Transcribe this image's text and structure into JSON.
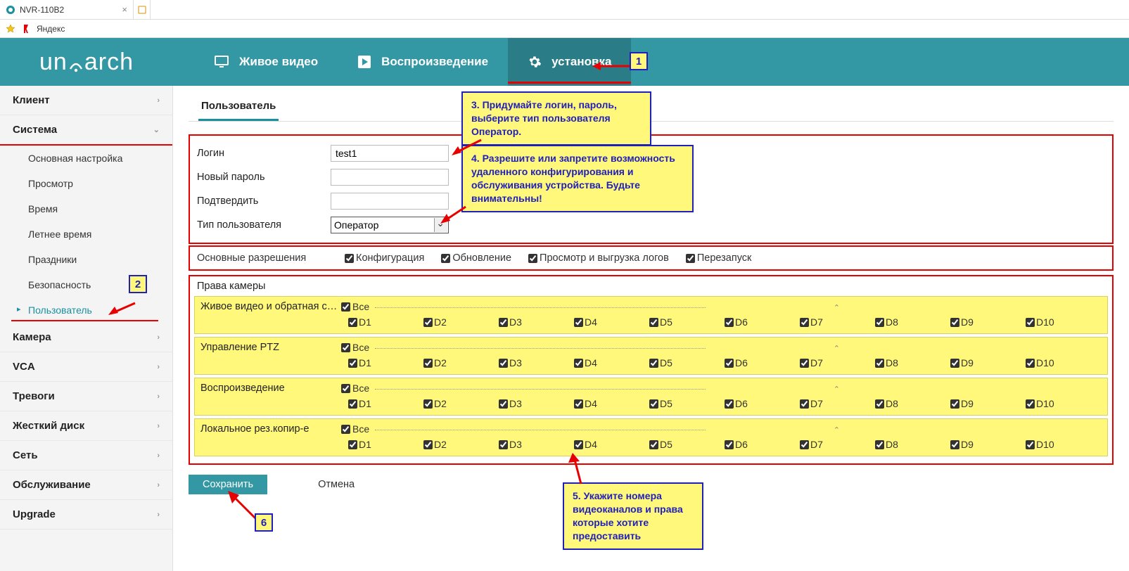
{
  "browser": {
    "tab_title": "NVR-110B2",
    "bookmark": "Яндекс"
  },
  "brand": "uniarch",
  "topnav": {
    "live": "Живое видео",
    "playback": "Воспроизведение",
    "setup": "установка"
  },
  "sidebar": {
    "client": "Клиент",
    "system": "Система",
    "system_items": {
      "basic": "Основная настройка",
      "preview": "Просмотр",
      "time": "Время",
      "dst": "Летнее время",
      "holiday": "Праздники",
      "security": "Безопасность",
      "user": "Пользователь"
    },
    "camera": "Камера",
    "vca": "VCA",
    "alarm": "Тревоги",
    "hdd": "Жесткий диск",
    "net": "Сеть",
    "maint": "Обслуживание",
    "upgrade": "Upgrade"
  },
  "content_tab": "Пользователь",
  "form": {
    "login_label": "Логин",
    "login_value": "test1",
    "newpw_label": "Новый пароль",
    "confirm_label": "Подтвердить",
    "usertype_label": "Тип пользователя",
    "usertype_value": "Оператор"
  },
  "perm": {
    "title": "Основные разрешения",
    "config": "Конфигурация",
    "update": "Обновление",
    "logs": "Просмотр и выгрузка логов",
    "restart": "Перезапуск"
  },
  "camera_rights": {
    "title": "Права камеры",
    "all": "Все",
    "groups": [
      "Живое видео и обратная с…",
      "Управление PTZ",
      "Воспроизведение",
      "Локальное рез.копир-е"
    ],
    "channels": [
      "D1",
      "D2",
      "D3",
      "D4",
      "D5",
      "D6",
      "D7",
      "D8",
      "D9",
      "D10"
    ]
  },
  "buttons": {
    "save": "Сохранить",
    "cancel": "Отмена"
  },
  "callouts": {
    "c1": "1",
    "c2": "2",
    "c6": "6",
    "note3": "3. Придумайте логин, пароль, выберите тип пользователя Оператор.",
    "note4": "4. Разрешите или запретите возможность удаленного конфигурирования и обслуживания устройства. Будьте внимательны!",
    "note5": "5. Укажите номера видеоканалов и права которые хотите предоставить"
  }
}
